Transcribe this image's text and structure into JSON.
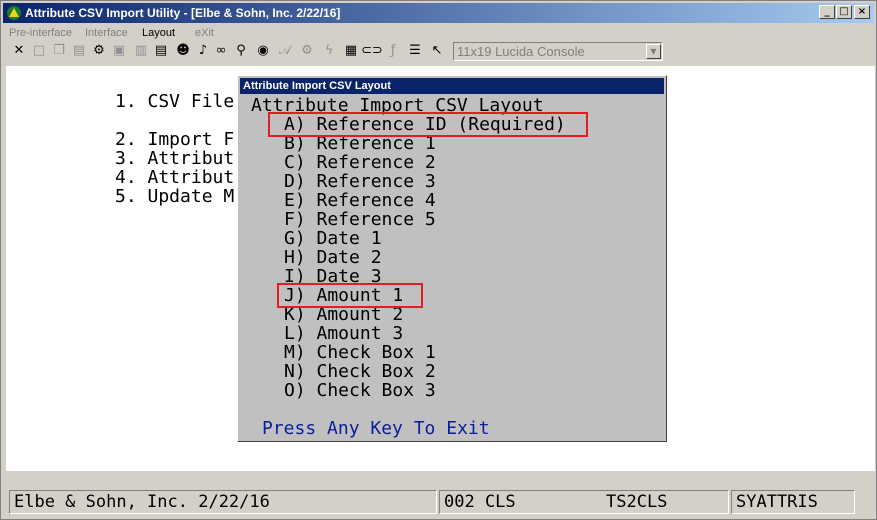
{
  "window": {
    "title": "Attribute CSV Import Utility - [Elbe & Sohn, Inc. 2/22/16]",
    "buttons": {
      "minimize": "_",
      "maximize": "□",
      "close": "×"
    }
  },
  "menubar": {
    "items": [
      {
        "label": "Pre-interface"
      },
      {
        "label": "Interface"
      },
      {
        "label": "Layout"
      },
      {
        "label": "eXit"
      }
    ]
  },
  "toolbar": {
    "font_select": {
      "value": "11x19 Lucida Console"
    }
  },
  "main_menu": {
    "lines": [
      "1. CSV File",
      "",
      "2. Import F",
      "3. Attribut",
      "4. Attribut",
      "5. Update M"
    ]
  },
  "dialog": {
    "title": "Attribute Import CSV Layout",
    "heading": "Attribute Import CSV Layout",
    "options": [
      "A) Reference ID (Required)",
      "B) Reference 1",
      "C) Reference 2",
      "D) Reference 3",
      "E) Reference 4",
      "F) Reference 5",
      "G) Date 1",
      "H) Date 2",
      "I) Date 3",
      "J) Amount 1",
      "K) Amount 2",
      "L) Amount 3",
      "M) Check Box 1",
      "N) Check Box 2",
      "O) Check Box 3"
    ],
    "footer": "Press Any Key To Exit",
    "highlight_color": "#e02020"
  },
  "statusbar": {
    "company": "Elbe & Sohn, Inc. 2/22/16",
    "code": "002 CLS",
    "server": "TS2CLS",
    "program": "SYATTRIS"
  }
}
